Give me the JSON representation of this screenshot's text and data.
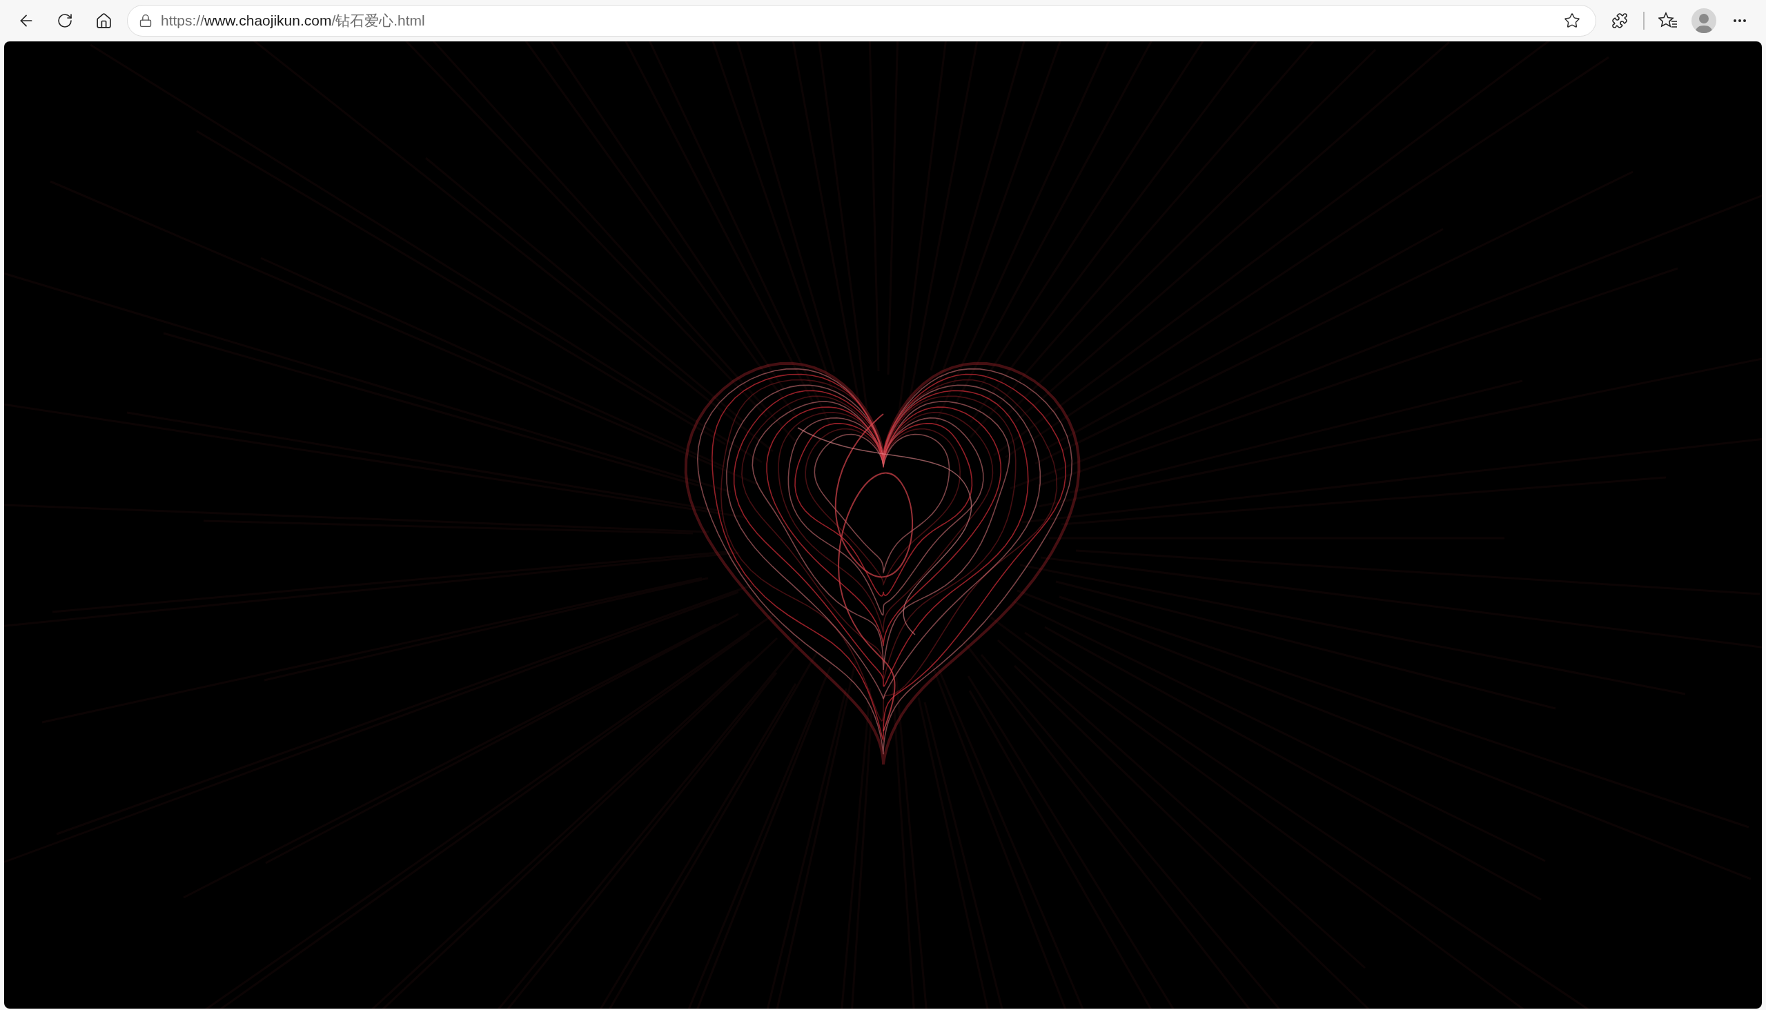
{
  "address_bar": {
    "scheme": "https://",
    "host": "www.chaojikun.com",
    "path": "/钻石爱心.html"
  }
}
